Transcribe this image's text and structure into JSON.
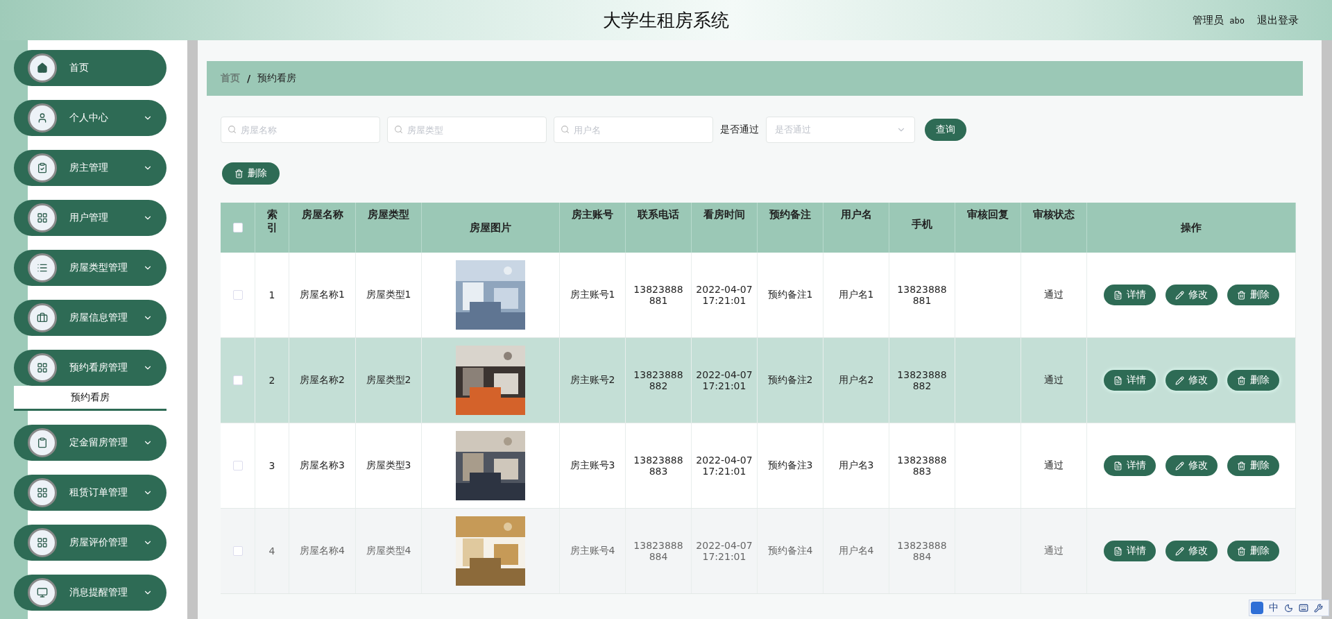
{
  "header": {
    "title": "大学生租房系统",
    "role": "管理员",
    "user": "abo",
    "logout": "退出登录"
  },
  "sidebar": {
    "items": [
      {
        "label": "首页",
        "kind": "link"
      },
      {
        "label": "个人中心",
        "kind": "menu"
      },
      {
        "label": "房主管理",
        "kind": "menu"
      },
      {
        "label": "用户管理",
        "kind": "menu"
      },
      {
        "label": "房屋类型管理",
        "kind": "menu"
      },
      {
        "label": "房屋信息管理",
        "kind": "menu"
      },
      {
        "label": "预约看房管理",
        "kind": "menu",
        "children": [
          {
            "label": "预约看房",
            "selected": true
          }
        ]
      },
      {
        "label": "定金留房管理",
        "kind": "menu"
      },
      {
        "label": "租赁订单管理",
        "kind": "menu"
      },
      {
        "label": "房屋评价管理",
        "kind": "menu"
      },
      {
        "label": "消息提醒管理",
        "kind": "menu"
      }
    ]
  },
  "breadcrumb": {
    "items": [
      "首页",
      "预约看房"
    ],
    "separator": "/"
  },
  "filters": {
    "fields": [
      {
        "placeholder": "房屋名称"
      },
      {
        "placeholder": "房屋类型"
      },
      {
        "placeholder": "用户名"
      }
    ],
    "select_label": "是否通过",
    "select": {
      "placeholder": "是否通过"
    },
    "search_button": "查询"
  },
  "bulk_delete": "删除",
  "table": {
    "select_all": {
      "checked": false
    },
    "columns": [
      "索引",
      "房屋名称",
      "房屋类型",
      "房屋图片",
      "房主账号",
      "联系电话",
      "看房时间",
      "预约备注",
      "用户名",
      "手机",
      "审核回复",
      "审核状态",
      "操作"
    ],
    "rows": [
      {
        "checked": false,
        "highlighted": false,
        "index": "1",
        "name": "房屋名称1",
        "type": "房屋类型1",
        "image": {
          "kind": "picture"
        },
        "owner": "房主账号1",
        "phone": "13823888881",
        "time": "2022-04-07 17:21:01",
        "note": "预约备注1",
        "username": "用户名1",
        "mobile": "13823888881",
        "status": "通过",
        "actions": [
          "详情",
          "修改",
          "删除"
        ]
      },
      {
        "checked": false,
        "highlighted": true,
        "index": "2",
        "name": "房屋名称2",
        "type": "房屋类型2",
        "image": {
          "kind": "picture"
        },
        "owner": "房主账号2",
        "phone": "13823888882",
        "time": "2022-04-07 17:21:01",
        "note": "预约备注2",
        "username": "用户名2",
        "mobile": "13823888882",
        "status": "通过",
        "actions": [
          "详情",
          "修改",
          "删除"
        ]
      },
      {
        "checked": false,
        "highlighted": false,
        "index": "3",
        "name": "房屋名称3",
        "type": "房屋类型3",
        "image": {
          "kind": "picture"
        },
        "owner": "房主账号3",
        "phone": "13823888883",
        "time": "2022-04-07 17:21:01",
        "note": "预约备注3",
        "username": "用户名3",
        "mobile": "13823888883",
        "status": "通过",
        "actions": [
          "详情",
          "修改",
          "删除"
        ]
      },
      {
        "checked": false,
        "highlighted": false,
        "index": "4",
        "name": "房屋名称4",
        "type": "房屋类型4",
        "image": {
          "kind": "picture"
        },
        "owner": "房主账号4",
        "phone": "13823888884",
        "time": "2022-04-07 17:21:01",
        "note": "预约备注4",
        "username": "用户名4",
        "mobile": "13823888884",
        "status": "通过",
        "actions": [
          "详情",
          "修改",
          "删除"
        ]
      }
    ]
  },
  "ime_toolbar": {
    "mode": "中"
  }
}
